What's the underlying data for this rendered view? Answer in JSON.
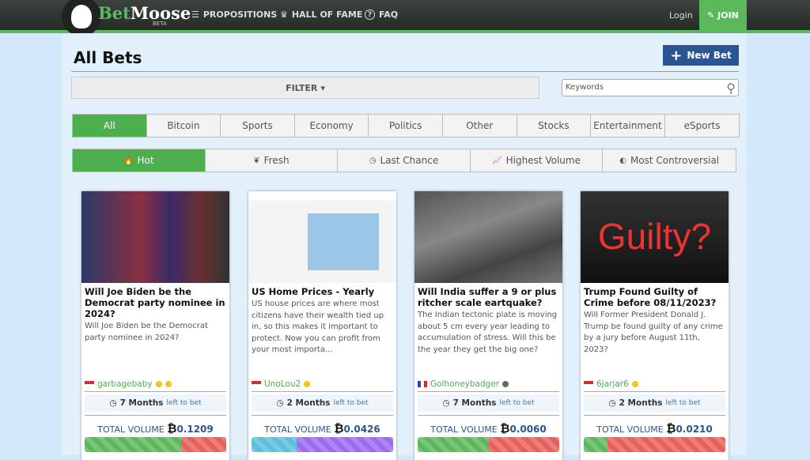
{
  "header": {
    "brand_b": "Bet",
    "brand_rest": "Moose",
    "beta": "BETA",
    "nav": [
      {
        "icon": "coins-icon",
        "glyph": "☰",
        "label": "PROPOSITIONS"
      },
      {
        "icon": "trophy-icon",
        "glyph": "♛",
        "label": "HALL OF FAME"
      },
      {
        "icon": "question-icon",
        "glyph": "?",
        "label": "FAQ"
      }
    ],
    "login": "Login",
    "join": "JOIN"
  },
  "page": {
    "title": "All Bets",
    "new_bet": "New Bet",
    "filter": "FILTER",
    "search_placeholder": "Keywords"
  },
  "categories": [
    {
      "label": "All",
      "active": true
    },
    {
      "label": "Bitcoin"
    },
    {
      "label": "Sports"
    },
    {
      "label": "Economy"
    },
    {
      "label": "Politics"
    },
    {
      "label": "Other"
    },
    {
      "label": "Stocks"
    },
    {
      "label": "Entertainment"
    },
    {
      "label": "eSports"
    }
  ],
  "sorts": [
    {
      "label": "Hot",
      "glyph": "🔥",
      "active": true
    },
    {
      "label": "Fresh",
      "glyph": "❦"
    },
    {
      "label": "Last Chance",
      "glyph": "◷"
    },
    {
      "label": "Highest Volume",
      "glyph": "📈"
    },
    {
      "label": "Most Controversial",
      "glyph": "◐"
    }
  ],
  "cards": [
    {
      "title": "Will Joe Biden be the Democrat party nominee in 2024?",
      "desc": "Will Joe Biden be the Democrat party nominee in 2024?",
      "user": "garbagebaby",
      "flag": "US",
      "dots": [
        "#f0c419",
        "#f0c419"
      ],
      "time": "7 Months",
      "time_suffix": "left to bet",
      "volume_label": "TOTAL VOLUME",
      "volume": "0.1209",
      "split": 0.68,
      "colors": [
        "#5cb85c",
        "#e8605a"
      ],
      "image_overlay": ""
    },
    {
      "title": "US Home Prices - Yearly",
      "desc": "US house prices are where most citizens have their wealth tied up in, so this makes it important to protect. Now you can profit from your most importa...",
      "user": "UnoLou2",
      "flag": "US",
      "dots": [
        "#f0c419"
      ],
      "time": "2 Months",
      "time_suffix": "left to bet",
      "volume_label": "TOTAL VOLUME",
      "volume": "0.0426",
      "split": 0.32,
      "colors": [
        "#5bc0de",
        "#9b6bf0"
      ],
      "image_overlay": ""
    },
    {
      "title": "Will India suffer a 9 or plus ritcher scale eartquake?",
      "desc": "The Indian tectonic plate is moving about 5 cm every year leading to accumulation of stress. Will this be the year they get the big one?",
      "user": "Golhoneybadger",
      "flag": "FR",
      "dots": [
        "#666666"
      ],
      "time": "7 Months",
      "time_suffix": "left to bet",
      "volume_label": "TOTAL VOLUME",
      "volume": "0.0060",
      "split": 0.5,
      "colors": [
        "#5cb85c",
        "#e8605a"
      ],
      "image_overlay": ""
    },
    {
      "title": "Trump Found Guilty of Crime before 08/11/2023?",
      "desc": "Will Former President Donald J. Trump be found guilty of any crime by a jury before August 11th, 2023?",
      "user": "6jarjar6",
      "flag": "US",
      "dots": [
        "#f0c419"
      ],
      "time": "2 Months",
      "time_suffix": "left to bet",
      "volume_label": "TOTAL VOLUME",
      "volume": "0.0210",
      "split": 0.17,
      "colors": [
        "#5cb85c",
        "#e8605a"
      ],
      "image_overlay": "Guilty?"
    }
  ]
}
